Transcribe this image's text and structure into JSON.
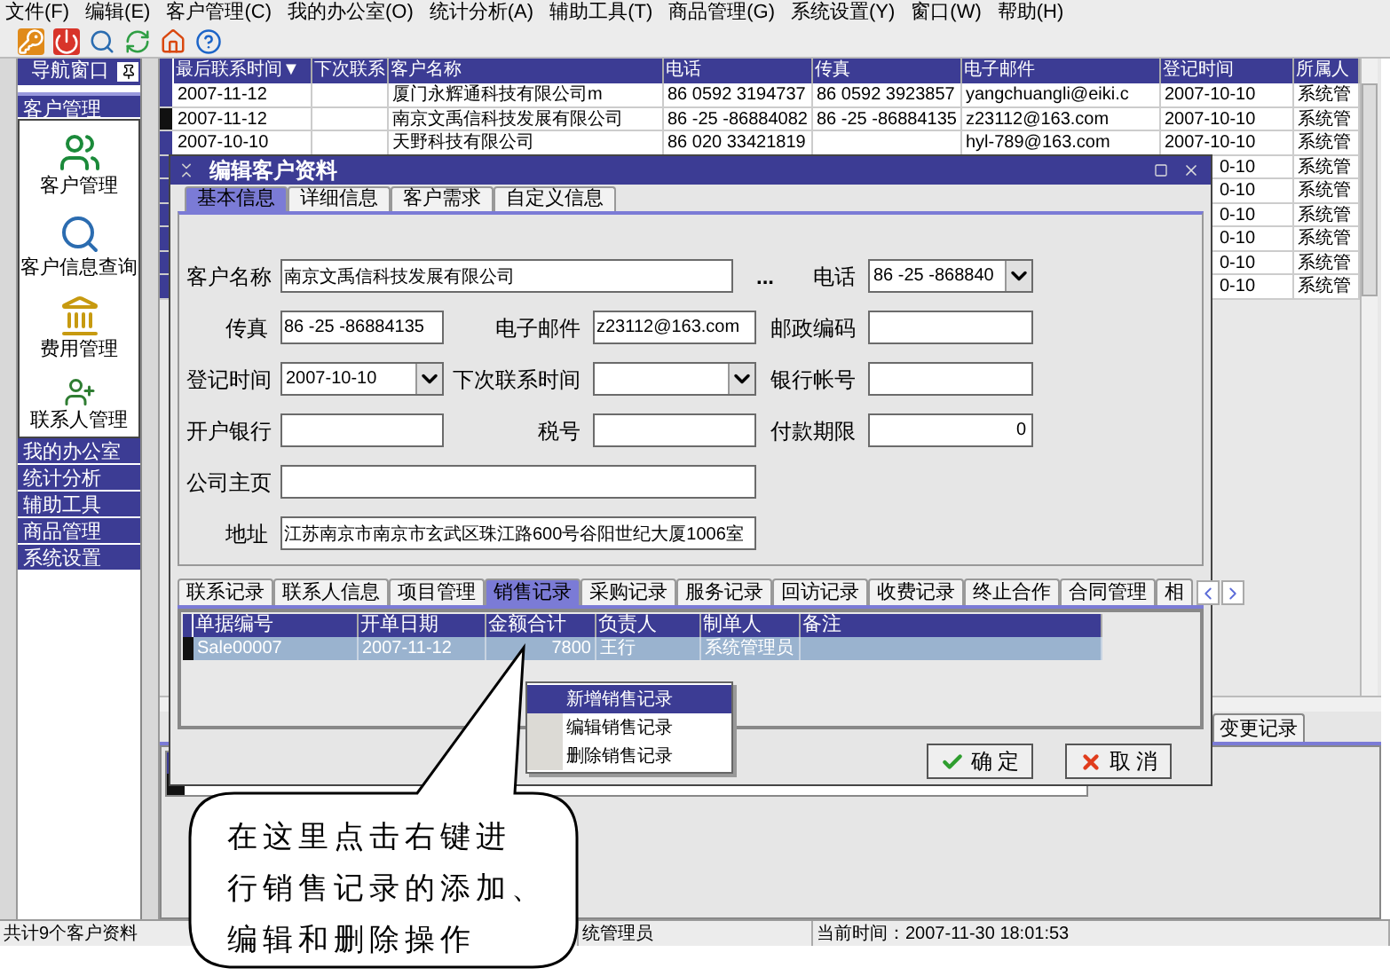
{
  "menu_bar": [
    "文件(F)",
    "编辑(E)",
    "客户管理(C)",
    "我的办公室(O)",
    "统计分析(A)",
    "辅助工具(T)",
    "商品管理(G)",
    "系统设置(Y)",
    "窗口(W)",
    "帮助(H)"
  ],
  "sidebar": {
    "title": "导航窗口",
    "groups": [
      {
        "label": "客户管理",
        "expanded": true,
        "items": [
          "客户管理",
          "客户信息查询",
          "费用管理",
          "联系人管理"
        ]
      },
      {
        "label": "我的办公室",
        "expanded": false
      },
      {
        "label": "统计分析",
        "expanded": false
      },
      {
        "label": "辅助工具",
        "expanded": false
      },
      {
        "label": "商品管理",
        "expanded": false
      },
      {
        "label": "系统设置",
        "expanded": false
      }
    ]
  },
  "customer_table": {
    "columns": [
      "最后联系时间▼",
      "下次联系",
      "客户名称",
      "电话",
      "传真",
      "电子邮件",
      "登记时间",
      "所属人"
    ],
    "rows": [
      {
        "selected": false,
        "last_contact": "2007-11-12",
        "name": "厦门永辉通科技有限公司m",
        "phone": "86 0592 3194737",
        "fax": "86 0592 3923857",
        "email": "yangchuangli@eiki.c",
        "registered": "2007-10-10",
        "owner": "系统管"
      },
      {
        "selected": true,
        "last_contact": "2007-11-12",
        "name": "南京文禹信科技发展有限公司",
        "phone": "86 -25 -86884082",
        "fax": "86 -25 -86884135",
        "email": "z23112@163.com",
        "registered": "2007-10-10",
        "owner": "系统管"
      },
      {
        "selected": false,
        "last_contact": "2007-10-10",
        "name": "天野科技有限公司",
        "phone": "86 020 33421819",
        "email": "hyl-789@163.com",
        "registered": "2007-10-10",
        "owner": "系统管"
      },
      {
        "selected": false,
        "registered": "0-10",
        "owner": "系统管"
      },
      {
        "selected": false,
        "registered": "0-10",
        "owner": "系统管"
      },
      {
        "selected": false,
        "registered": "0-10",
        "owner": "系统管"
      },
      {
        "selected": false,
        "registered": "0-10",
        "owner": "系统管"
      },
      {
        "selected": false,
        "registered": "0-10",
        "owner": "系统管"
      },
      {
        "selected": false,
        "registered": "0-10",
        "owner": "系统管"
      }
    ]
  },
  "lower_tabs": [
    {
      "label": "变更记录",
      "selected": false
    }
  ],
  "status_bar": [
    "共计9个客户资料",
    "统管理员",
    "当前时间：2007-11-30 18:01:53"
  ],
  "dialog": {
    "title": "编辑客户资料",
    "tabs": [
      {
        "label": "基本信息",
        "selected": true
      },
      {
        "label": "详细信息",
        "selected": false
      },
      {
        "label": "客户需求",
        "selected": false
      },
      {
        "label": "自定义信息",
        "selected": false
      }
    ],
    "form": [
      [
        {
          "label": "客户名称",
          "value": "南京文禹信科技发展有限公司",
          "kind": "lookup",
          "button": "..."
        },
        {
          "label": "电话",
          "value": "86 -25 -868840",
          "kind": "select"
        }
      ],
      [
        {
          "label": "传真",
          "value": "86 -25 -86884135",
          "kind": "text"
        },
        {
          "label": "电子邮件",
          "value": "z23112@163.com",
          "kind": "text"
        },
        {
          "label": "邮政编码",
          "kind": "text"
        }
      ],
      [
        {
          "label": "登记时间",
          "value": "2007-10-10",
          "kind": "select"
        },
        {
          "label": "下次联系时间",
          "kind": "select"
        },
        {
          "label": "银行帐号",
          "kind": "text"
        }
      ],
      [
        {
          "label": "开户银行",
          "kind": "text"
        },
        {
          "label": "税号",
          "kind": "text"
        },
        {
          "label": "付款期限",
          "value": "0",
          "kind": "number"
        }
      ],
      [
        {
          "label": "公司主页",
          "kind": "wide"
        }
      ],
      [
        {
          "label": "地址",
          "value": "江苏南京市南京市玄武区珠江路600号谷阳世纪大厦1006室",
          "kind": "wide"
        }
      ]
    ],
    "record_tabs": [
      {
        "label": "联系记录",
        "selected": false
      },
      {
        "label": "联系人信息",
        "selected": false
      },
      {
        "label": "项目管理",
        "selected": false
      },
      {
        "label": "销售记录",
        "selected": true
      },
      {
        "label": "采购记录",
        "selected": false
      },
      {
        "label": "服务记录",
        "selected": false
      },
      {
        "label": "回访记录",
        "selected": false
      },
      {
        "label": "收费记录",
        "selected": false
      },
      {
        "label": "终止合作",
        "selected": false
      },
      {
        "label": "合同管理",
        "selected": false
      },
      {
        "label": "相",
        "selected": false
      }
    ],
    "records": {
      "columns": [
        "单据编号",
        "开单日期",
        "金额合计",
        "负责人",
        "制单人",
        "备注"
      ],
      "rows": [
        {
          "selected": true,
          "cells": [
            "Sale00007",
            "2007-11-12",
            "7800",
            "王行",
            "系统管理员"
          ]
        }
      ]
    },
    "buttons": [
      {
        "label": "确 定",
        "kind": "ok"
      },
      {
        "label": "取 消",
        "kind": "cancel"
      }
    ]
  },
  "context_menu": [
    {
      "label": "新增销售记录",
      "selected": true
    },
    {
      "label": "编辑销售记录",
      "selected": false
    },
    {
      "label": "删除销售记录",
      "selected": false
    }
  ],
  "callout": {
    "lines": [
      "在这里点击右键进",
      "行销售记录的添加、",
      "编辑和删除操作"
    ]
  }
}
